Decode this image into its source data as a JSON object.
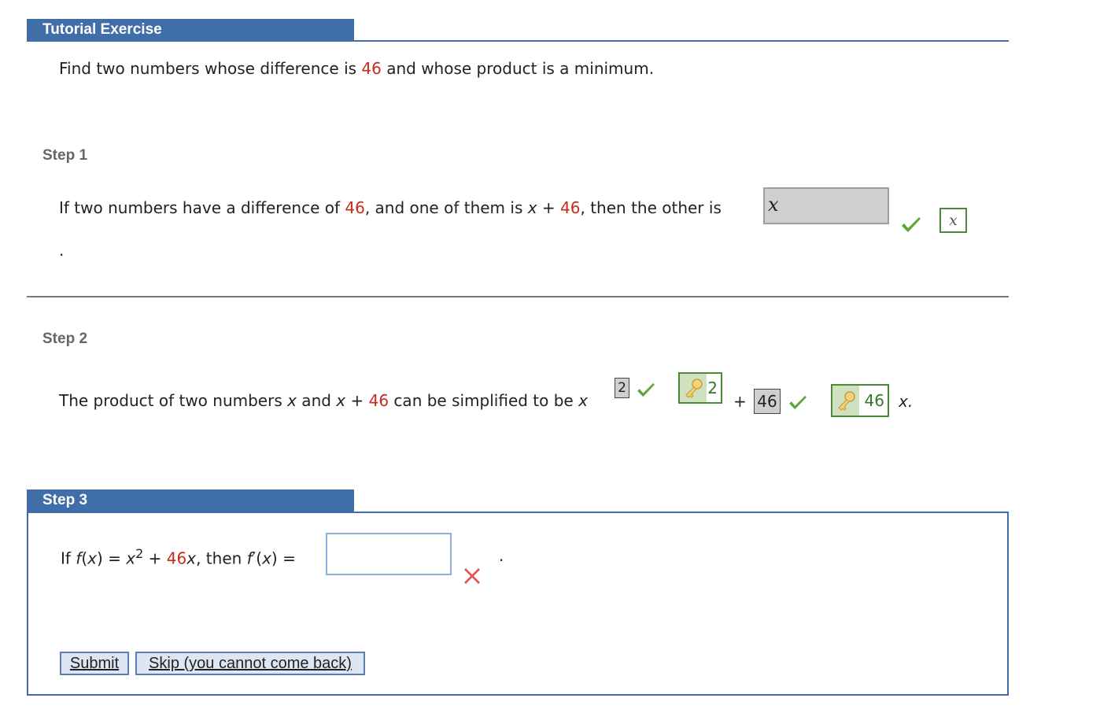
{
  "header": {
    "title": "Tutorial Exercise"
  },
  "problem": {
    "pre": "Find two numbers whose difference is ",
    "num": "46",
    "post": " and whose product is a minimum."
  },
  "step1": {
    "label": "Step 1",
    "t1": "If two numbers have a difference of ",
    "n1": "46",
    "t2": ", and one of them is ",
    "var": "x",
    "t3": " + ",
    "n2": "46",
    "t4": ", then the other is",
    "answer": "x",
    "period": ".",
    "preview": "x"
  },
  "step2": {
    "label": "Step 2",
    "t1": "The product of two numbers ",
    "v1": "x",
    "t2": " and ",
    "v2": "x",
    "t3": " + ",
    "n1": "46",
    "t4": " can be simplified to be ",
    "v3": "x",
    "exp_answer": "2",
    "key1": "2",
    "plus": "+",
    "coef_answer": "46",
    "key2": "46",
    "tail": "x."
  },
  "step3": {
    "label": "Step 3",
    "p1": "If ",
    "f1": "f",
    "p2": "(",
    "v1": "x",
    "p3": ") = ",
    "v2": "x",
    "sup": "2",
    "p4": " + ",
    "n1": "46",
    "v3": "x",
    "p5": ", then ",
    "f2": "f",
    "p6": "′(",
    "v4": "x",
    "p7": ") =",
    "answer": "",
    "period": ".",
    "submit": "Submit",
    "skip": "Skip (you cannot come back)"
  },
  "colors": {
    "accent": "#3f6ea8",
    "highlight": "#c92a1e",
    "correct": "#5aa83a",
    "wrong": "#e05a5a"
  }
}
